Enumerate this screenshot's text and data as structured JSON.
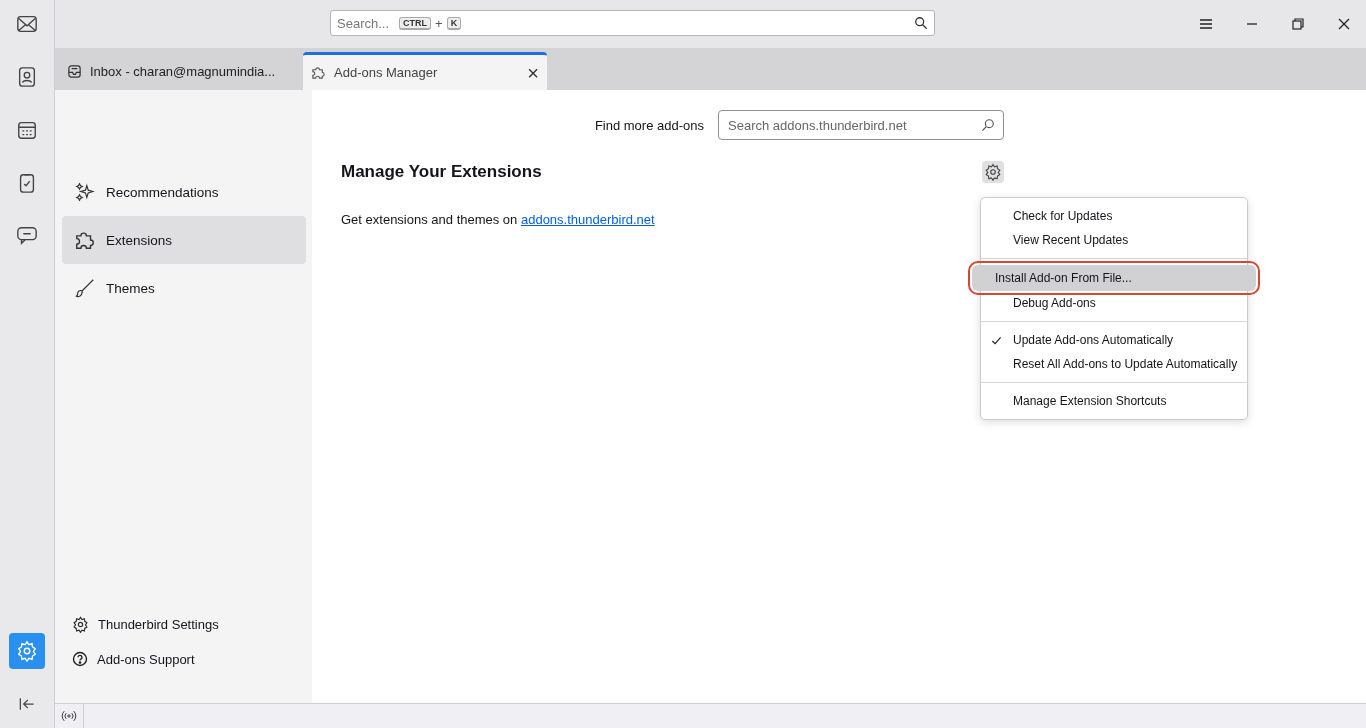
{
  "spaces": [
    {
      "kind": "mail",
      "selected": false
    },
    {
      "kind": "contacts",
      "selected": false
    },
    {
      "kind": "calendar",
      "selected": false
    },
    {
      "kind": "tasks",
      "selected": false
    },
    {
      "kind": "chat",
      "selected": false
    }
  ],
  "spaces_bottom": [
    {
      "kind": "settings",
      "selected": true
    }
  ],
  "global_search": {
    "placeholder": "Search...",
    "shortcut": [
      "CTRL",
      "+",
      "K"
    ]
  },
  "tabs": [
    {
      "label": "Inbox - charan@magnumindia...",
      "kind": "inbox",
      "selected": false,
      "closable": false
    },
    {
      "label": "Add-ons Manager",
      "kind": "addons",
      "selected": true,
      "closable": true
    }
  ],
  "tab_close": "×",
  "sidebar": {
    "items": [
      {
        "label": "Recommendations",
        "kind": "sparkle",
        "selected": false
      },
      {
        "label": "Extensions",
        "kind": "puzzle",
        "selected": true
      },
      {
        "label": "Themes",
        "kind": "brush",
        "selected": false
      }
    ],
    "footer": [
      {
        "label": "Thunderbird Settings",
        "kind": "gear"
      },
      {
        "label": "Add-ons Support",
        "kind": "help"
      }
    ]
  },
  "find_more": {
    "label": "Find more add-ons",
    "placeholder": "Search addons.thunderbird.net"
  },
  "heading": "Manage Your Extensions",
  "intro": {
    "text": "Get extensions and themes on",
    "link": "addons.thunderbird.net"
  },
  "menu": {
    "items": [
      {
        "kind": "item",
        "label": "Check for Updates",
        "checked": false,
        "highlighted": false
      },
      {
        "kind": "item",
        "label": "View Recent Updates",
        "checked": false,
        "highlighted": false
      },
      {
        "kind": "separator"
      },
      {
        "kind": "item",
        "label": "Install Add-on From File...",
        "checked": false,
        "highlighted": true
      },
      {
        "kind": "item",
        "label": "Debug Add-ons",
        "checked": false,
        "highlighted": false
      },
      {
        "kind": "separator"
      },
      {
        "kind": "item",
        "label": "Update Add-ons Automatically",
        "checked": true,
        "highlighted": false
      },
      {
        "kind": "item",
        "label": "Reset All Add-ons to Update Automatically",
        "checked": false,
        "highlighted": false
      },
      {
        "kind": "separator"
      },
      {
        "kind": "item",
        "label": "Manage Extension Shortcuts",
        "checked": false,
        "highlighted": false
      }
    ]
  }
}
